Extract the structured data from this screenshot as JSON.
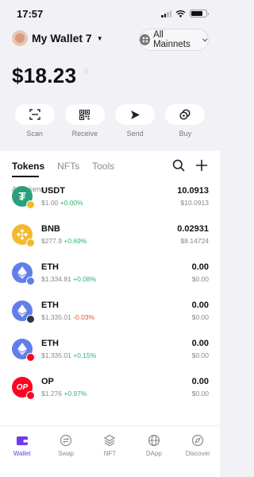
{
  "status": {
    "time": "17:57"
  },
  "header": {
    "wallet_name": "My Wallet 7",
    "network_label": "All Mainnets"
  },
  "balance": {
    "amount": "$18.23"
  },
  "actions": [
    {
      "label": "Scan",
      "icon": "scan-icon"
    },
    {
      "label": "Receive",
      "icon": "qr-code-icon"
    },
    {
      "label": "Send",
      "icon": "send-arrow-icon"
    },
    {
      "label": "Buy",
      "icon": "coins-icon"
    }
  ],
  "tabs": [
    {
      "label": "Tokens",
      "active": true
    },
    {
      "label": "NFTs",
      "active": false
    },
    {
      "label": "Tools",
      "active": false
    }
  ],
  "filter": {
    "label": "All tokens"
  },
  "tokens": [
    {
      "symbol": "USDT",
      "price": "$1.00",
      "change": "+0.00%",
      "amount": "10.0913",
      "value": "$10.0913",
      "color": "#26a17b",
      "chain_color": "#f3ba2f"
    },
    {
      "symbol": "BNB",
      "price": "$277.9",
      "change": "+0.69%",
      "amount": "0.02931",
      "value": "$8.14724",
      "color": "#f3ba2f",
      "chain_color": "#f3ba2f"
    },
    {
      "symbol": "ETH",
      "price": "$1,334.81",
      "change": "+0.08%",
      "amount": "0.00",
      "value": "$0.00",
      "color": "#627eea",
      "chain_color": "#627eea"
    },
    {
      "symbol": "ETH",
      "price": "$1,335.01",
      "change": "-0.03%",
      "amount": "0.00",
      "value": "$0.00",
      "color": "#627eea",
      "chain_color": "#2d374b"
    },
    {
      "symbol": "ETH",
      "price": "$1,335.01",
      "change": "+0.15%",
      "amount": "0.00",
      "value": "$0.00",
      "color": "#627eea",
      "chain_color": "#ff0420"
    },
    {
      "symbol": "OP",
      "price": "$1.276",
      "change": "+0.97%",
      "amount": "0.00",
      "value": "$0.00",
      "color": "#ff0420",
      "chain_color": "#ff0420"
    }
  ],
  "nav": [
    {
      "label": "Wallet",
      "active": true
    },
    {
      "label": "Swap",
      "active": false
    },
    {
      "label": "NFT",
      "active": false
    },
    {
      "label": "DApp",
      "active": false
    },
    {
      "label": "Discover",
      "active": false
    }
  ],
  "colors": {
    "accent": "#6b3bf0",
    "up": "#2bb673",
    "down": "#e5533c",
    "background": "#f2f2f6"
  }
}
